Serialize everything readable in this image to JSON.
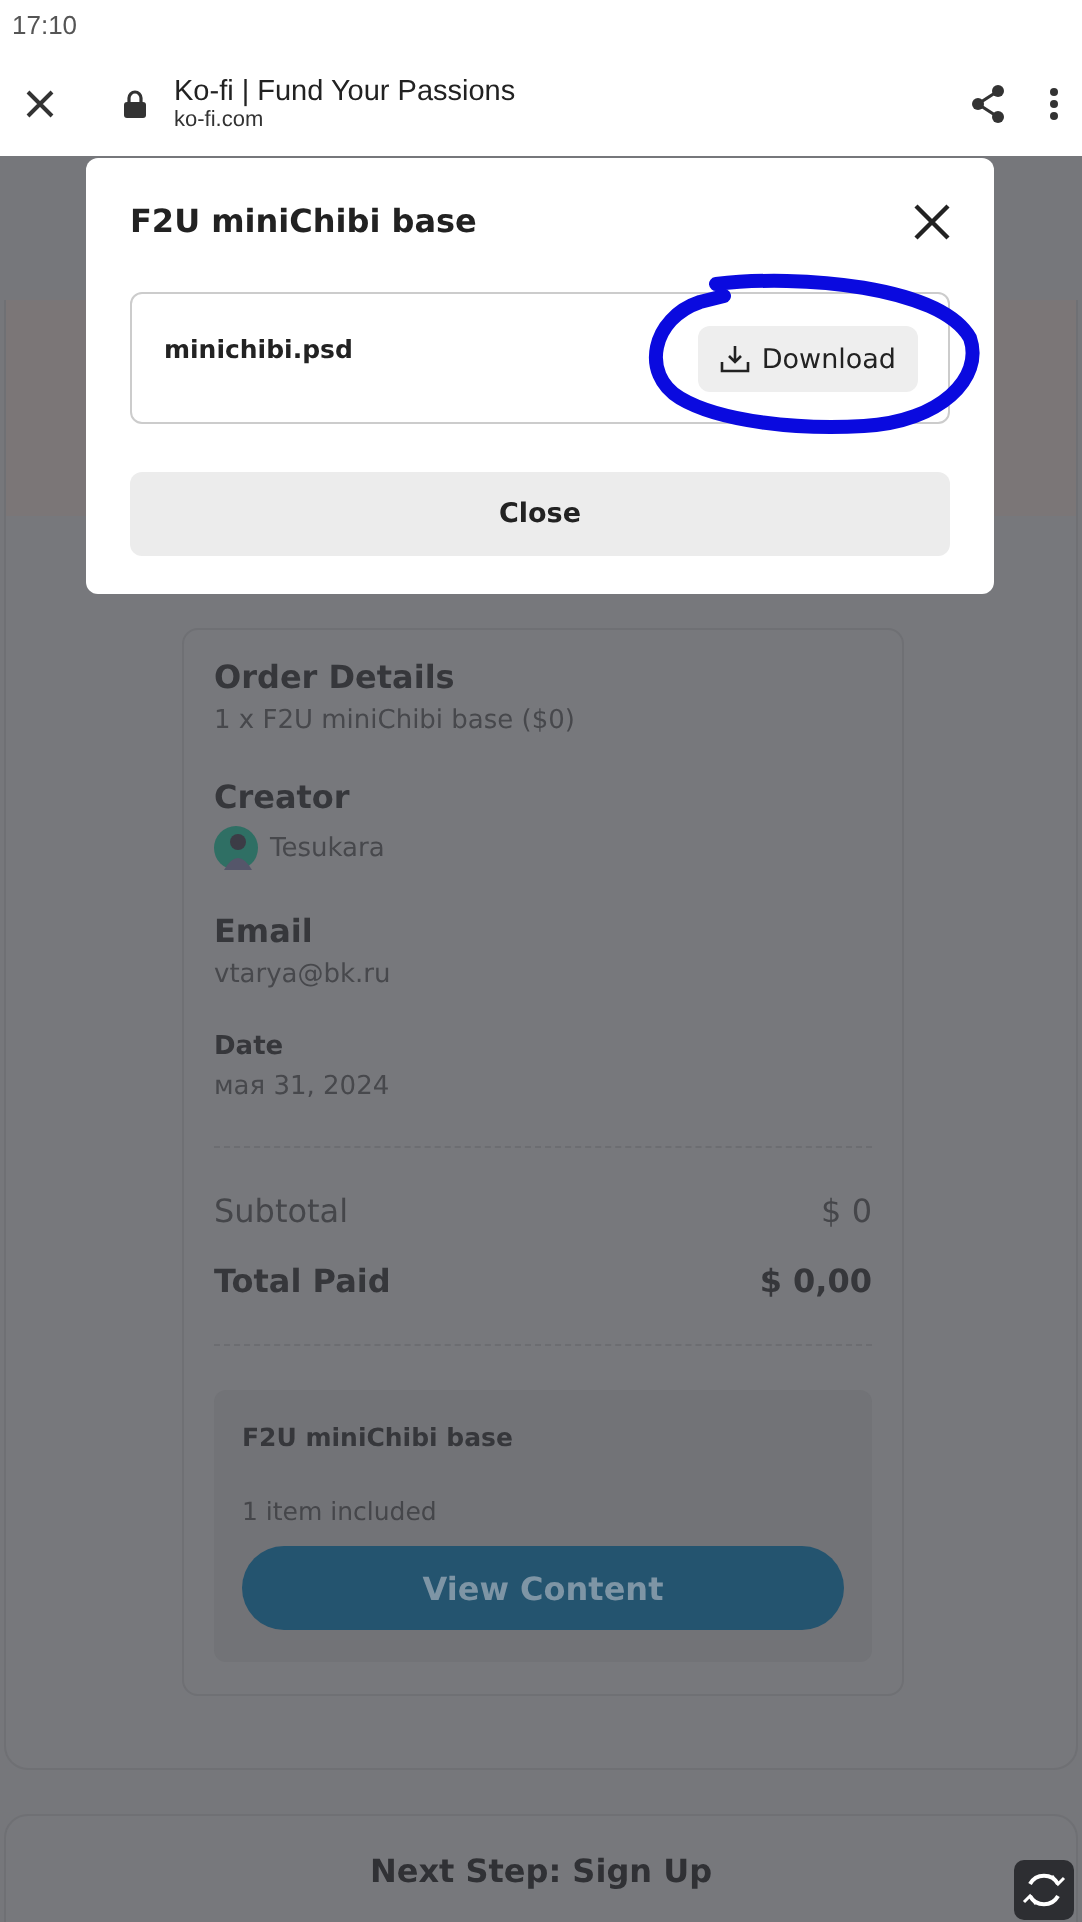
{
  "status_bar": {
    "time": "17:10"
  },
  "browser": {
    "title": "Ko-fi | Fund Your Passions",
    "url": "ko-fi.com"
  },
  "modal": {
    "title": "F2U miniChibi base",
    "file": {
      "name": "minichibi.psd",
      "button": "Download",
      "annotated": true
    },
    "close_button": "Close"
  },
  "order": {
    "sections": [
      {
        "heading": "Order Details",
        "value": "1 x F2U miniChibi base ($0)",
        "kind": "text"
      },
      {
        "heading": "Creator",
        "value": "Tesukara",
        "kind": "avatar"
      },
      {
        "heading": "Email",
        "value": "vtarya@bk.ru",
        "kind": "text"
      },
      {
        "heading": "Date",
        "value": "мая 31, 2024",
        "kind": "small"
      }
    ],
    "subtotal": {
      "label": "Subtotal",
      "value": "$ 0"
    },
    "total": {
      "label": "Total Paid",
      "value": "$ 0,00"
    },
    "product": {
      "title": "F2U miniChibi base",
      "count": "1 item included",
      "button": "View Content"
    }
  },
  "next_step": {
    "title": "Next Step: Sign Up"
  }
}
